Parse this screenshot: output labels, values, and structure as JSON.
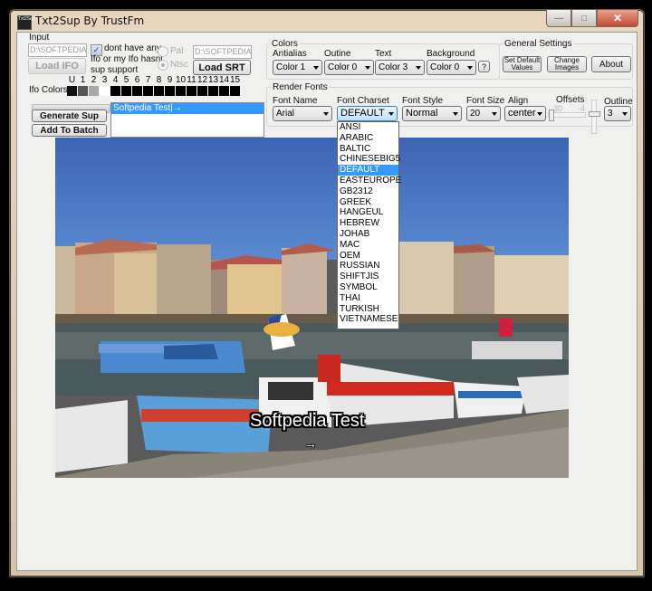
{
  "window": {
    "title": "Txt2Sup By TrustFm",
    "icon_text": "Txt2Sup",
    "controls": {
      "minimize": "—",
      "maximize": "□",
      "close": "✕"
    }
  },
  "input": {
    "group_label": "Input",
    "ifo_path": "D:\\SOFTPEDIA\\S",
    "load_ifo_label": "Load IFO",
    "no_ifo_checkbox": {
      "checked": true,
      "label_line1": "dont have any",
      "label_line2": "Ifo or my Ifo hasnt",
      "label_line3": "sup support"
    },
    "video_standard": {
      "options": [
        "Pal",
        "Ntsc"
      ],
      "selected": "Ntsc"
    },
    "srt_path": "D:\\SOFTPEDIA\\S",
    "load_srt_label": "Load SRT",
    "ifo_colors_label": "Ifo Colors:",
    "color_indices": [
      "U",
      "1",
      "2",
      "3",
      "4",
      "5",
      "6",
      "7",
      "8",
      "9",
      "10",
      "11",
      "12",
      "13",
      "14",
      "15"
    ],
    "swatch_colors": [
      "#111111",
      "#555555",
      "#a8a8a8",
      "#ffffff",
      "#000000",
      "#000000",
      "#000000",
      "#000000",
      "#000000",
      "#000000",
      "#000000",
      "#000000",
      "#000000",
      "#000000",
      "#000000",
      "#000000"
    ]
  },
  "colors": {
    "group_label": "Colors",
    "antialias": {
      "label": "Antialias",
      "value": "Color 1"
    },
    "outline": {
      "label": "Outine",
      "value": "Color 0"
    },
    "text": {
      "label": "Text",
      "value": "Color 3"
    },
    "background": {
      "label": "Background",
      "value": "Color 0"
    },
    "help_label": "?"
  },
  "general": {
    "group_label": "General Settings",
    "set_default_line1": "Set Default",
    "set_default_line2": "Values",
    "change_images_line1": "Change",
    "change_images_line2": "Images",
    "about_label": "About"
  },
  "render_fonts": {
    "group_label": "Render Fonts",
    "font_name": {
      "label": "Font Name",
      "value": "Arial"
    },
    "font_charset": {
      "label": "Font Charset",
      "value": "DEFAULT",
      "options": [
        "ANSI",
        "ARABIC",
        "BALTIC",
        "CHINESEBIG5",
        "DEFAULT",
        "EASTEUROPE",
        "GB2312",
        "GREEK",
        "HANGEUL",
        "HEBREW",
        "JOHAB",
        "MAC",
        "OEM",
        "RUSSIAN",
        "SHIFTJIS",
        "SYMBOL",
        "THAI",
        "TURKISH",
        "VIETNAMESE"
      ]
    },
    "font_style": {
      "label": "Font Style",
      "value": "Normal"
    },
    "font_size": {
      "label": "Font Size",
      "value": "20"
    },
    "align": {
      "label": "Align",
      "value": "center"
    },
    "offsets": {
      "label": "Offsets",
      "x_value": "30",
      "y_value": "-4"
    },
    "outline": {
      "label": "Outline",
      "value": "3"
    }
  },
  "actions": {
    "generate_sup_label": "Generate Sup",
    "add_to_batch_label": "Add To Batch"
  },
  "subtitle_list": {
    "items": [
      "Softpedia Test|→"
    ]
  },
  "preview": {
    "subtitle_text": "Softpedia Test",
    "arrow_glyph": "→"
  }
}
